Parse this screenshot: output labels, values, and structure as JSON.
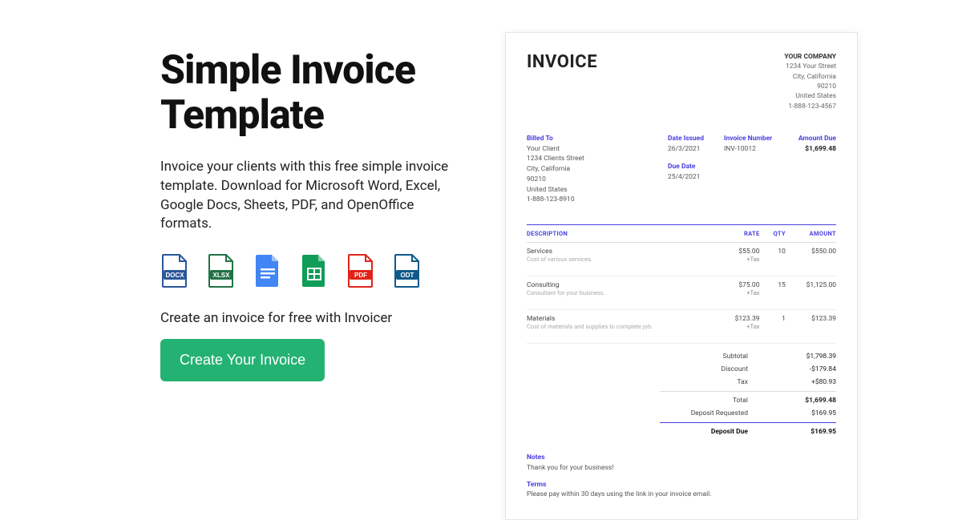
{
  "hero": {
    "title": "Simple Invoice Template",
    "subtitle": "Invoice your clients with this free simple invoice template. Download for Microsoft Word, Excel, Google Docs, Sheets, PDF, and OpenOffice formats.",
    "caption": "Create an invoice for free with Invoicer",
    "cta": "Create Your Invoice"
  },
  "filetypes": {
    "docx": "DOCX",
    "xlsx": "XLSX",
    "gdoc": "",
    "gsheet": "",
    "pdf": "PDF",
    "odt": "ODT"
  },
  "invoice": {
    "heading": "INVOICE",
    "company": {
      "name": "YOUR COMPANY",
      "street": "1234 Your Street",
      "city": "City, California",
      "zip": "90210",
      "country": "United States",
      "phone": "1-888-123-4567"
    },
    "billed": {
      "label": "Billed To",
      "name": "Your Client",
      "street": "1234 Clients Street",
      "city": "City, California",
      "zip": "90210",
      "country": "United States",
      "phone": "1-888-123-8910"
    },
    "date_issued": {
      "label": "Date Issued",
      "value": "26/3/2021"
    },
    "due_date": {
      "label": "Due Date",
      "value": "25/4/2021"
    },
    "inv_number": {
      "label": "Invoice Number",
      "value": "INV-10012"
    },
    "amount_due_label": "Amount Due",
    "amount_due_value": "$1,699.48",
    "cols": {
      "desc": "DESCRIPTION",
      "rate": "RATE",
      "qty": "QTY",
      "amount": "AMOUNT"
    },
    "items": [
      {
        "name": "Services",
        "note": "Cost of various services.",
        "rate": "$55.00",
        "tax": "+Tax",
        "qty": "10",
        "amount": "$550.00"
      },
      {
        "name": "Consulting",
        "note": "Consultant for your business.",
        "rate": "$75.00",
        "tax": "+Tax",
        "qty": "15",
        "amount": "$1,125.00"
      },
      {
        "name": "Materials",
        "note": "Cost of materials and supplies to complete job.",
        "rate": "$123.39",
        "tax": "+Tax",
        "qty": "1",
        "amount": "$123.39"
      }
    ],
    "totals": {
      "subtotal": {
        "label": "Subtotal",
        "value": "$1,798.39"
      },
      "discount": {
        "label": "Discount",
        "value": "-$179.84"
      },
      "tax": {
        "label": "Tax",
        "value": "+$80.93"
      },
      "total": {
        "label": "Total",
        "value": "$1,699.48"
      },
      "deposit_req": {
        "label": "Deposit Requested",
        "value": "$169.95"
      },
      "deposit_due": {
        "label": "Deposit Due",
        "value": "$169.95"
      }
    },
    "notes": {
      "label": "Notes",
      "text": "Thank you for your business!"
    },
    "terms": {
      "label": "Terms",
      "text": "Please pay within 30 days using the link in your invoice email."
    }
  }
}
